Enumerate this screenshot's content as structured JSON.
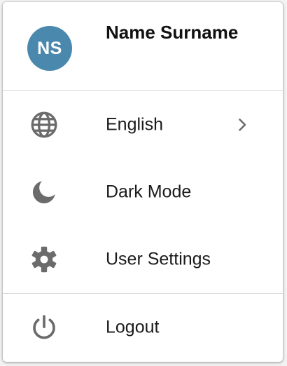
{
  "user": {
    "initials": "NS",
    "name": "Name Surname"
  },
  "menu": {
    "items": [
      {
        "label": "English",
        "icon": "globe-icon",
        "has_submenu": true
      },
      {
        "label": "Dark Mode",
        "icon": "moon-icon",
        "has_submenu": false
      },
      {
        "label": "User Settings",
        "icon": "gear-icon",
        "has_submenu": false
      },
      {
        "label": "Logout",
        "icon": "power-icon",
        "has_submenu": false
      }
    ]
  },
  "colors": {
    "avatar_bg": "#4a89ad",
    "icon": "#6b6b6b",
    "text": "#1a1a1a",
    "divider": "#d9d9d9"
  }
}
